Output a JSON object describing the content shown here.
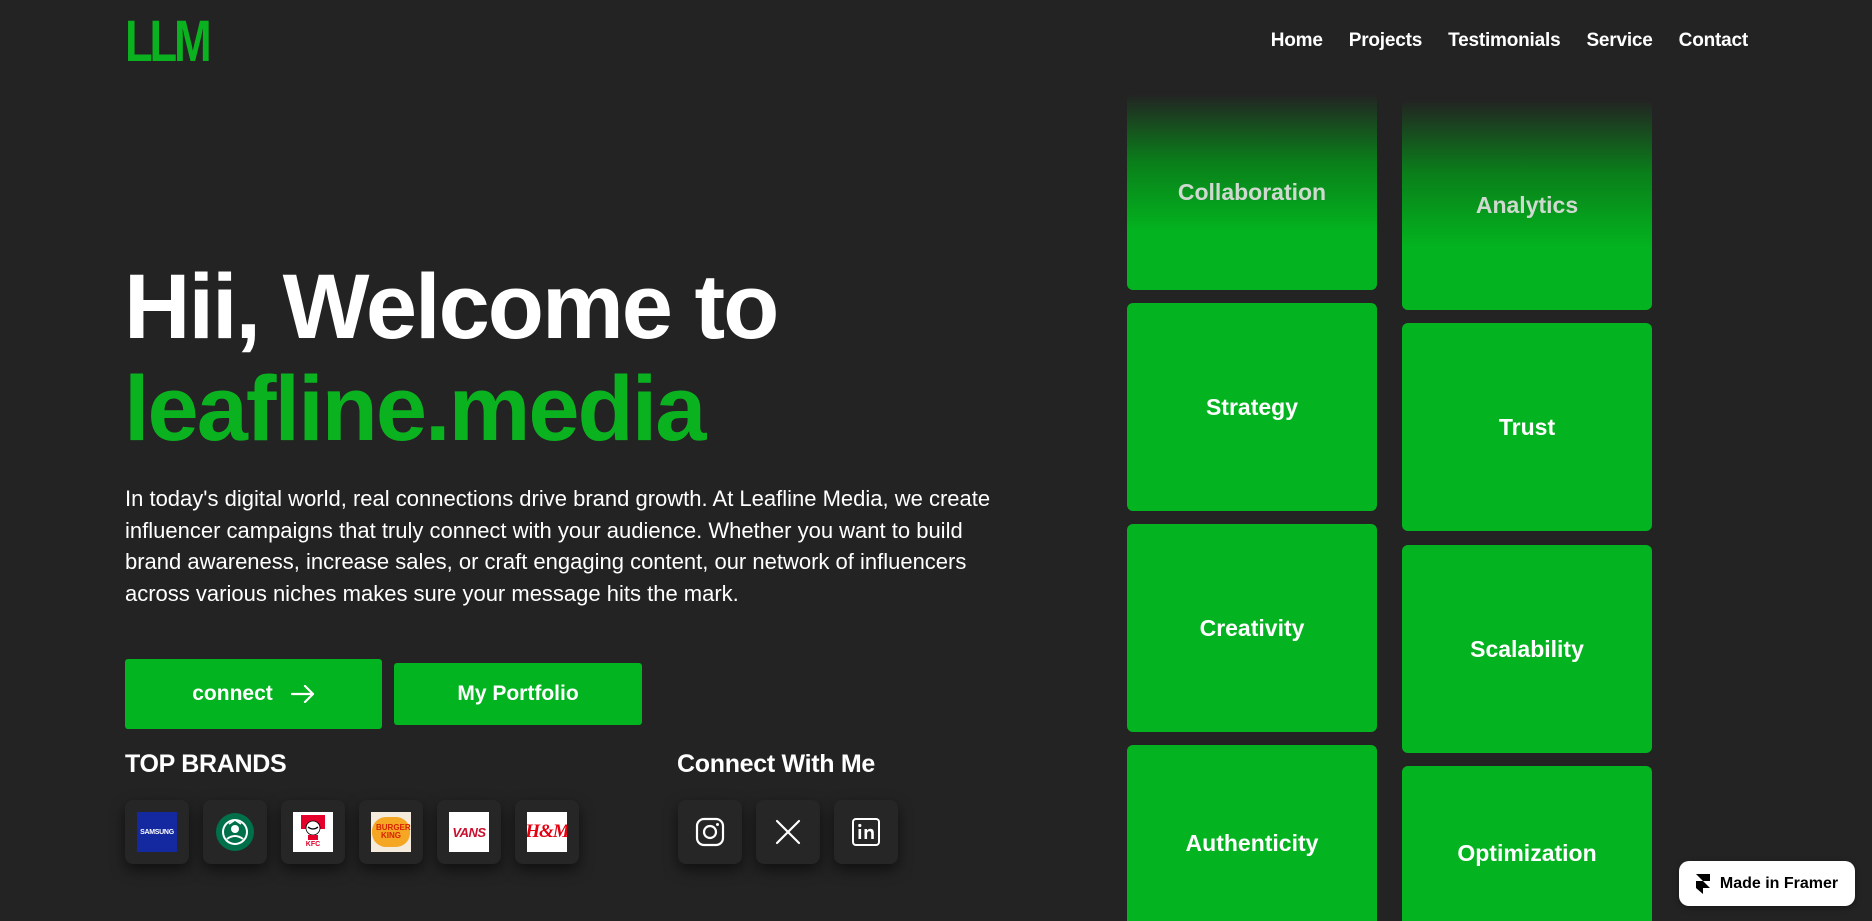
{
  "logo": "LLM",
  "nav": [
    "Home",
    "Projects",
    "Testimonials",
    "Service",
    "Contact"
  ],
  "hero": {
    "line1": "Hii, Welcome to",
    "line2": "leafline.media",
    "description": "In today's digital world, real connections drive brand growth. At Leafline Media, we create influencer campaigns that truly connect with your audience. Whether you want to build brand awareness, increase sales, or craft engaging content, our network of influencers across various niches makes sure your message hits the mark.",
    "connect_label": "connect",
    "portfolio_label": "My Portfolio"
  },
  "brands": {
    "label": "TOP BRANDS",
    "items": [
      {
        "text": "SAMSUNG",
        "icon": "samsung-logo"
      },
      {
        "text": "",
        "icon": "starbucks-logo"
      },
      {
        "text": "KFC",
        "icon": "kfc-logo"
      },
      {
        "text": "BURGER KING",
        "icon": "burger-king-logo"
      },
      {
        "text": "VANS",
        "icon": "vans-logo"
      },
      {
        "text": "H&M",
        "icon": "hm-logo"
      }
    ]
  },
  "social": {
    "label": "Connect With Me",
    "items": [
      "instagram-icon",
      "x-icon",
      "linkedin-icon"
    ]
  },
  "cards": {
    "col1": [
      "Collaboration",
      "Strategy",
      "Creativity",
      "Authenticity"
    ],
    "col2": [
      "Analytics",
      "Trust",
      "Scalability",
      "Optimization"
    ]
  },
  "colors": {
    "accent": "#0bb21f",
    "background": "#232323",
    "card": "#03b31f"
  },
  "badge": "Made in Framer"
}
